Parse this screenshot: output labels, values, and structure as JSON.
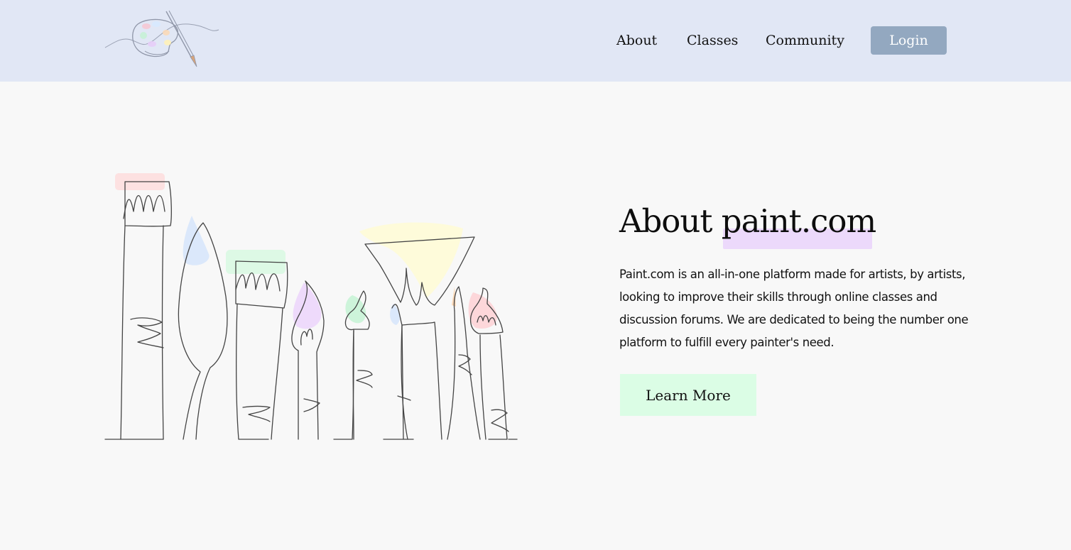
{
  "header": {
    "logo_icon": "paint-palette-brush-icon",
    "nav": {
      "about": "About",
      "classes": "Classes",
      "community": "Community"
    },
    "login_label": "Login",
    "login_color": "#93a8c0",
    "background_color": "#e1e7f5"
  },
  "hero": {
    "illustration_icon": "paintbrushes-line-art-icon",
    "title_prefix": "About ",
    "title_brand": "paint.com",
    "highlight_color": "#ecd9fb",
    "description": "Paint.com is an all-in-one platform made for artists, by artists, looking to improve their skills through online classes and discussion forums. We are dedicated to being the number one platform to fulfill every painter's need.",
    "cta_label": "Learn More",
    "cta_color": "#dbfde5"
  }
}
